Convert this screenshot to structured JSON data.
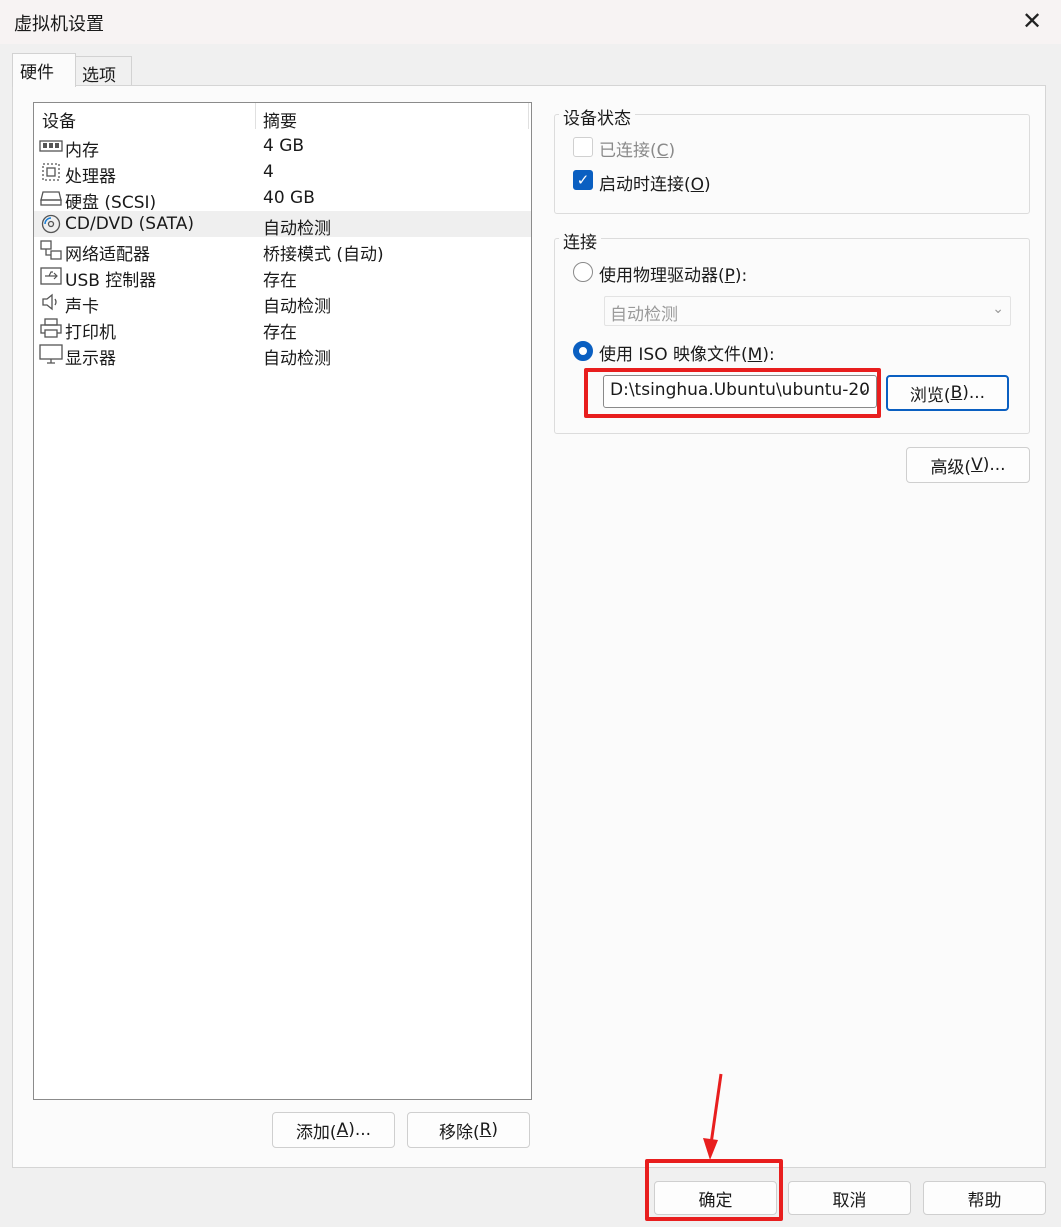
{
  "window": {
    "title": "虚拟机设置",
    "close_glyph": "✕"
  },
  "tabs": [
    {
      "label": "硬件"
    },
    {
      "label": "选项"
    }
  ],
  "device_list": {
    "col_device": "设备",
    "col_summary": "摘要",
    "rows": [
      {
        "name": "内存",
        "summary": "4 GB",
        "icon": "memory-icon"
      },
      {
        "name": "处理器",
        "summary": "4",
        "icon": "cpu-icon"
      },
      {
        "name": "硬盘 (SCSI)",
        "summary": "40 GB",
        "icon": "hard-disk-icon"
      },
      {
        "name": "CD/DVD (SATA)",
        "summary": "自动检测",
        "icon": "cd-dvd-icon",
        "selected": true
      },
      {
        "name": "网络适配器",
        "summary": "桥接模式 (自动)",
        "icon": "network-adapter-icon"
      },
      {
        "name": "USB 控制器",
        "summary": "存在",
        "icon": "usb-icon"
      },
      {
        "name": "声卡",
        "summary": "自动检测",
        "icon": "sound-card-icon"
      },
      {
        "name": "打印机",
        "summary": "存在",
        "icon": "printer-icon"
      },
      {
        "name": "显示器",
        "summary": "自动检测",
        "icon": "display-icon"
      }
    ]
  },
  "left_buttons": {
    "add_text": "添加(",
    "add_key": "A",
    "add_suffix": ")...",
    "remove_text": "移除(",
    "remove_key": "R",
    "remove_suffix": ")"
  },
  "device_status": {
    "legend": "设备状态",
    "connected_text": "已连接(",
    "connected_key": "C",
    "connected_suffix": ")",
    "connected_checked": false,
    "connected_disabled": true,
    "connect_on_power_text": "启动时连接(",
    "connect_on_power_key": "O",
    "connect_on_power_suffix": ")",
    "connect_on_power_checked": true
  },
  "connection": {
    "legend": "连接",
    "physical_text": "使用物理驱动器(",
    "physical_key": "P",
    "physical_suffix": "):",
    "physical_selected": false,
    "physical_drive_value": "自动检测",
    "iso_text": "使用 ISO 映像文件(",
    "iso_key": "M",
    "iso_suffix": "):",
    "iso_selected": true,
    "iso_path": "D:\\tsinghua.Ubuntu\\ubuntu-20",
    "browse_text": "浏览(",
    "browse_key": "B",
    "browse_suffix": ")..."
  },
  "advanced": {
    "text": "高级(",
    "key": "V",
    "suffix": ")..."
  },
  "footer": {
    "ok": "确定",
    "cancel": "取消",
    "help": "帮助"
  },
  "colors": {
    "accent": "#0a5fc1",
    "highlight": "#e81e1e"
  }
}
